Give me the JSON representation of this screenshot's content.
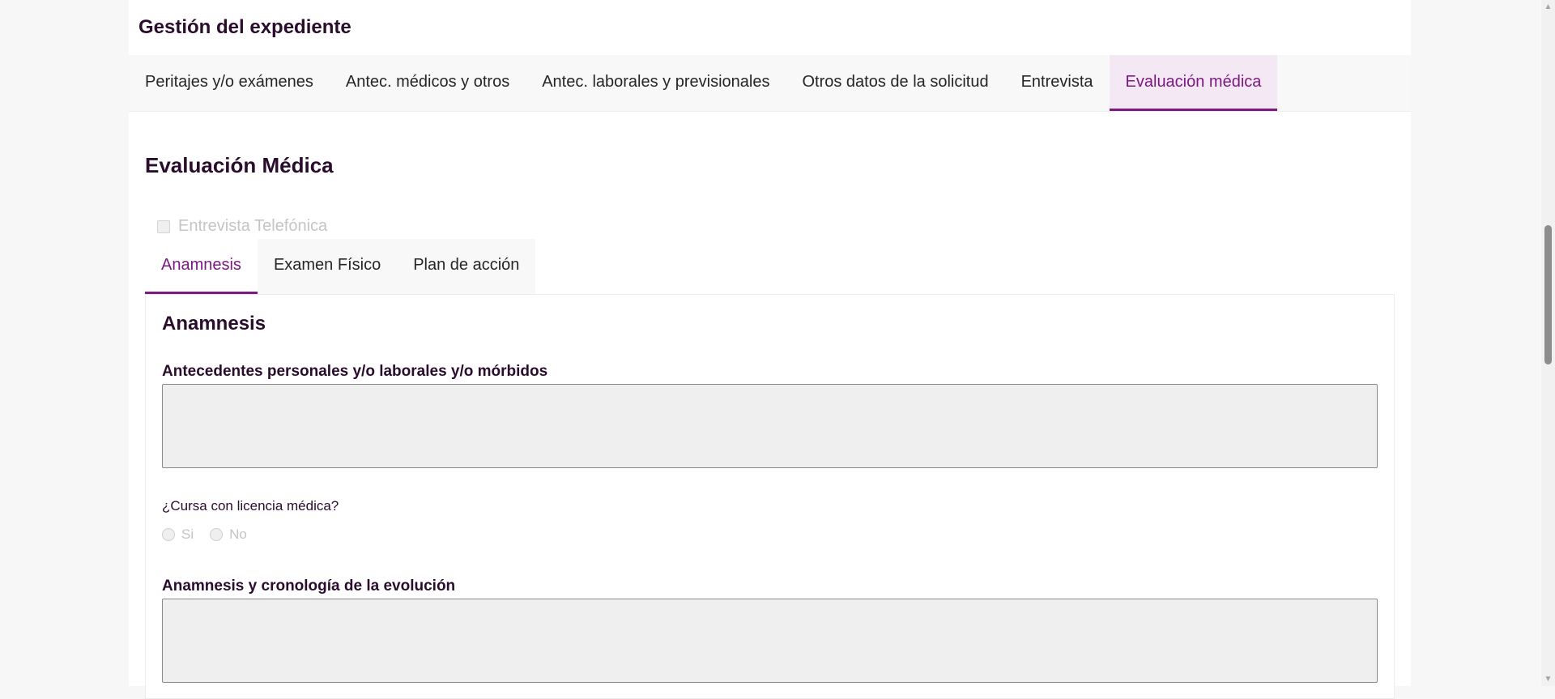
{
  "page": {
    "title": "Gestión del expediente"
  },
  "main_tabs": [
    {
      "label": "Peritajes y/o exámenes",
      "active": false
    },
    {
      "label": "Antec. médicos y otros",
      "active": false
    },
    {
      "label": "Antec. laborales y previsionales",
      "active": false
    },
    {
      "label": "Otros datos de la solicitud",
      "active": false
    },
    {
      "label": "Entrevista",
      "active": false
    },
    {
      "label": "Evaluación médica",
      "active": true
    }
  ],
  "section": {
    "title": "Evaluación Médica",
    "phone_interview_label": "Entrevista Telefónica",
    "phone_interview_checked": false
  },
  "sub_tabs": [
    {
      "label": "Anamnesis",
      "active": true
    },
    {
      "label": "Examen Físico",
      "active": false
    },
    {
      "label": "Plan de acción",
      "active": false
    }
  ],
  "panel": {
    "title": "Anamnesis",
    "antecedentes_label": "Antecedentes personales y/o laborales y/o mórbidos",
    "antecedentes_value": "",
    "license_question": "¿Cursa con licencia médica?",
    "license_options": [
      "Si",
      "No"
    ],
    "anamnesis_label": "Anamnesis y cronología de la evolución",
    "anamnesis_value": ""
  },
  "icons": {
    "scroll_up": "scroll-up-arrow-icon",
    "scroll_down": "scroll-down-arrow-icon"
  },
  "colors": {
    "accent": "#7d1a82",
    "heading": "#2a0c2d",
    "active_tab_bg": "#f4e8f4"
  }
}
